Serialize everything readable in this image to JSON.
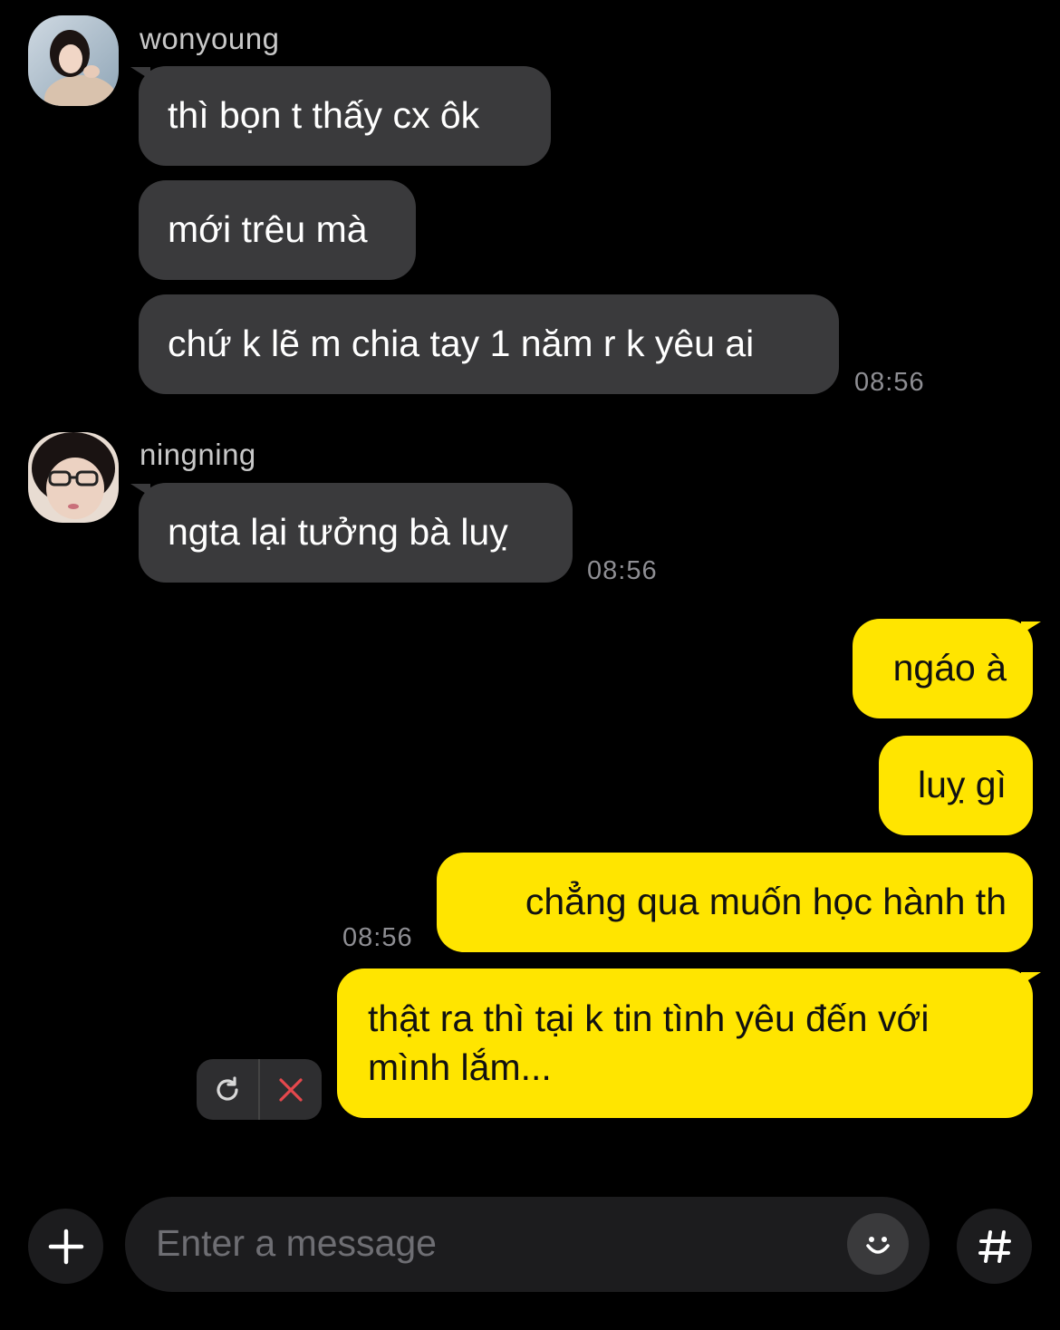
{
  "conversation": {
    "group1": {
      "sender": "wonyoung",
      "messages": [
        "thì bọn t thấy cx ôk",
        "mới trêu mà",
        "chứ k lẽ m chia tay 1 năm r k yêu ai"
      ],
      "time": "08:56"
    },
    "group2": {
      "sender": "ningning",
      "messages": [
        "ngta lại tưởng bà luỵ"
      ],
      "time": "08:56"
    },
    "outgoing": {
      "messages": [
        "ngáo à",
        "luỵ gì",
        "chẳng qua muốn học hành th"
      ],
      "time": "08:56",
      "failed_message_line1": "thật ra thì tại k tin tình yêu đến với",
      "failed_message_line2": "mình lắm..."
    }
  },
  "composer": {
    "placeholder": "Enter a message",
    "plus_icon": "plus-icon",
    "emoji_icon": "emoji-icon",
    "hash_icon": "hash-icon"
  },
  "colors": {
    "background": "#000000",
    "incoming_bubble": "#3a3a3c",
    "outgoing_bubble": "#ffe500",
    "timestamp": "#8e8e93",
    "cancel_red": "#e5484d"
  }
}
